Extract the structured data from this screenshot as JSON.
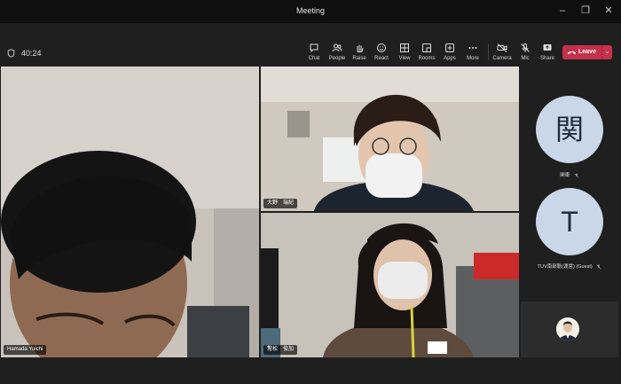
{
  "window": {
    "title": "Meeting"
  },
  "meeting": {
    "elapsed": "40:24"
  },
  "toolbar": {
    "chat": "Chat",
    "people": "People",
    "raise": "Raise",
    "react": "React",
    "view": "View",
    "rooms": "Rooms",
    "apps": "Apps",
    "more": "More",
    "camera": "Camera",
    "mic": "Mic",
    "share": "Share",
    "leave": "Leave"
  },
  "participants": {
    "video": [
      {
        "name": "Hamada Yuichi",
        "muted": false
      },
      {
        "name": "大野　瑞紀",
        "muted": false
      },
      {
        "name": "常松　俊加",
        "muted": true
      }
    ],
    "avatars": [
      {
        "initial": "関",
        "name": "関東",
        "muted": true
      },
      {
        "initial": "T",
        "name": "TUV南部聡(運営) (Guest)",
        "muted": true
      }
    ]
  },
  "colors": {
    "leave": "#c4314b",
    "titlebar": "#0f0f0f",
    "toolbar": "#1f1f1f",
    "avatar_bg": "#cad7e8"
  }
}
